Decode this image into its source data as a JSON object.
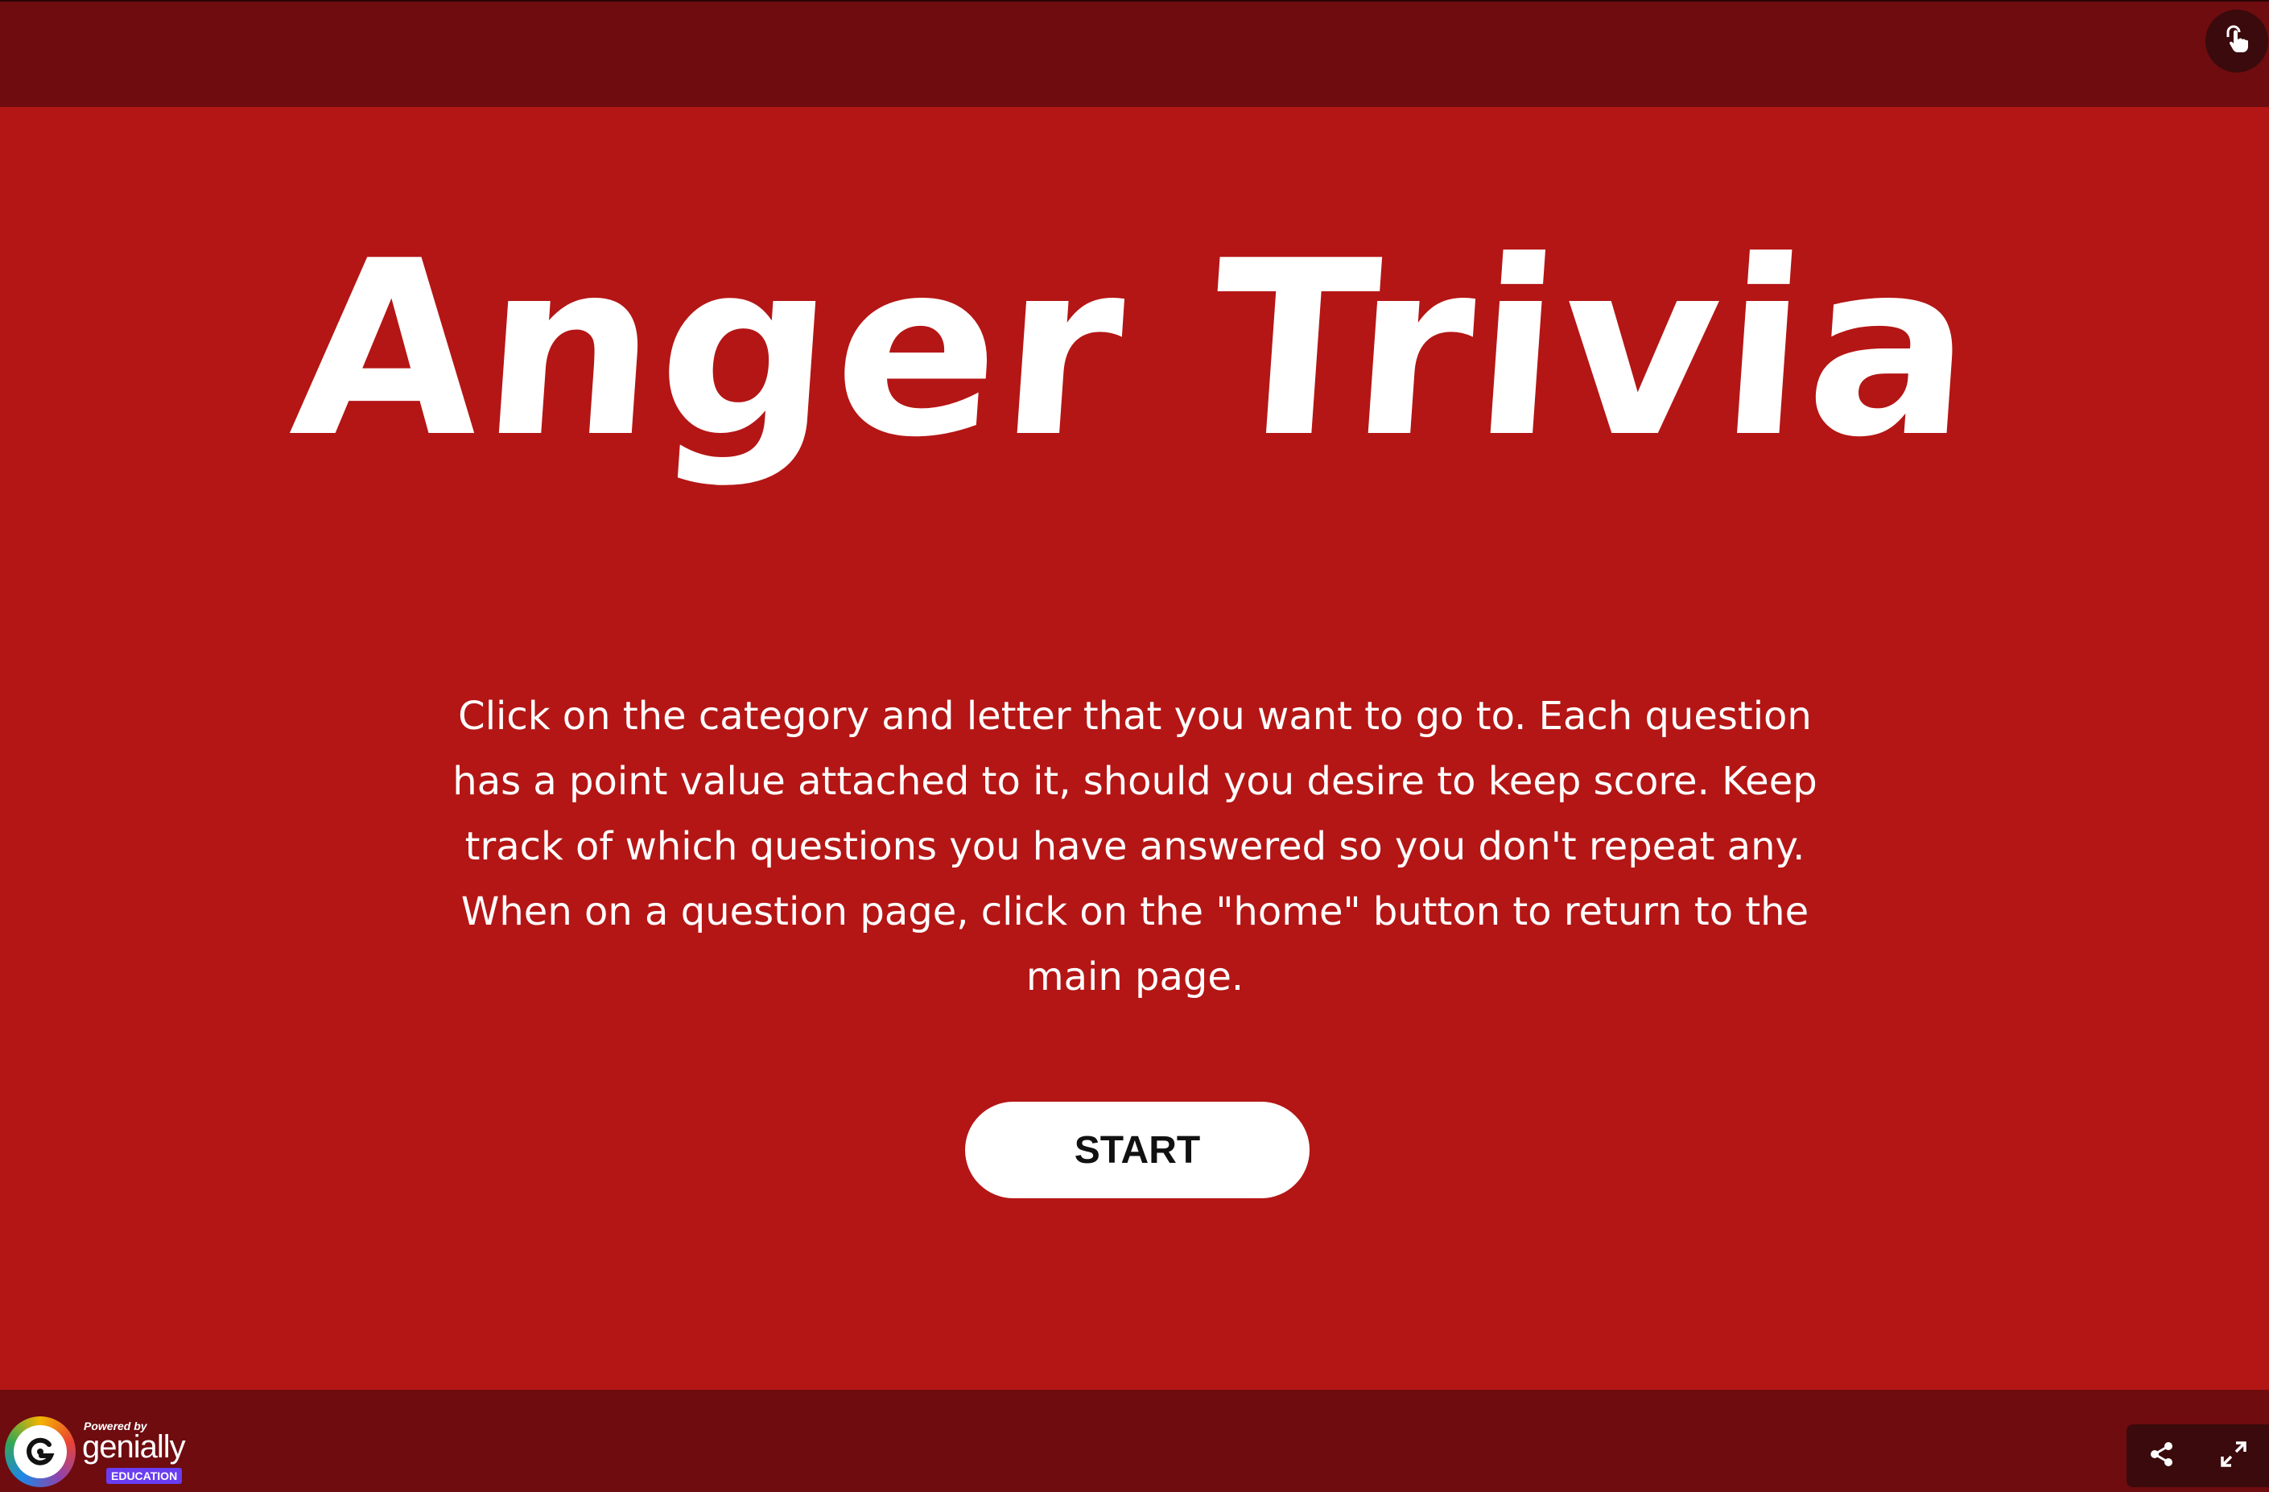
{
  "slide": {
    "title": "Anger Trivia",
    "description": "Click on the category and letter that you want to go to. Each question has a point value attached to it, should you desire to keep score.  Keep track of which questions you have answered so you don't repeat any. When on a question page, click on the \"home\" button to return to the main page.",
    "start_label": "START"
  },
  "branding": {
    "powered_by": "Powered by",
    "name": "genially",
    "edition": "EDUCATION"
  },
  "icons": {
    "top_right": "pointer-lock-icon",
    "share": "share-icon",
    "fullscreen": "fullscreen-icon"
  },
  "colors": {
    "slide_background": "#b41615",
    "frame": "#6e0c10",
    "text": "#ffffff",
    "button_background": "#ffffff"
  }
}
